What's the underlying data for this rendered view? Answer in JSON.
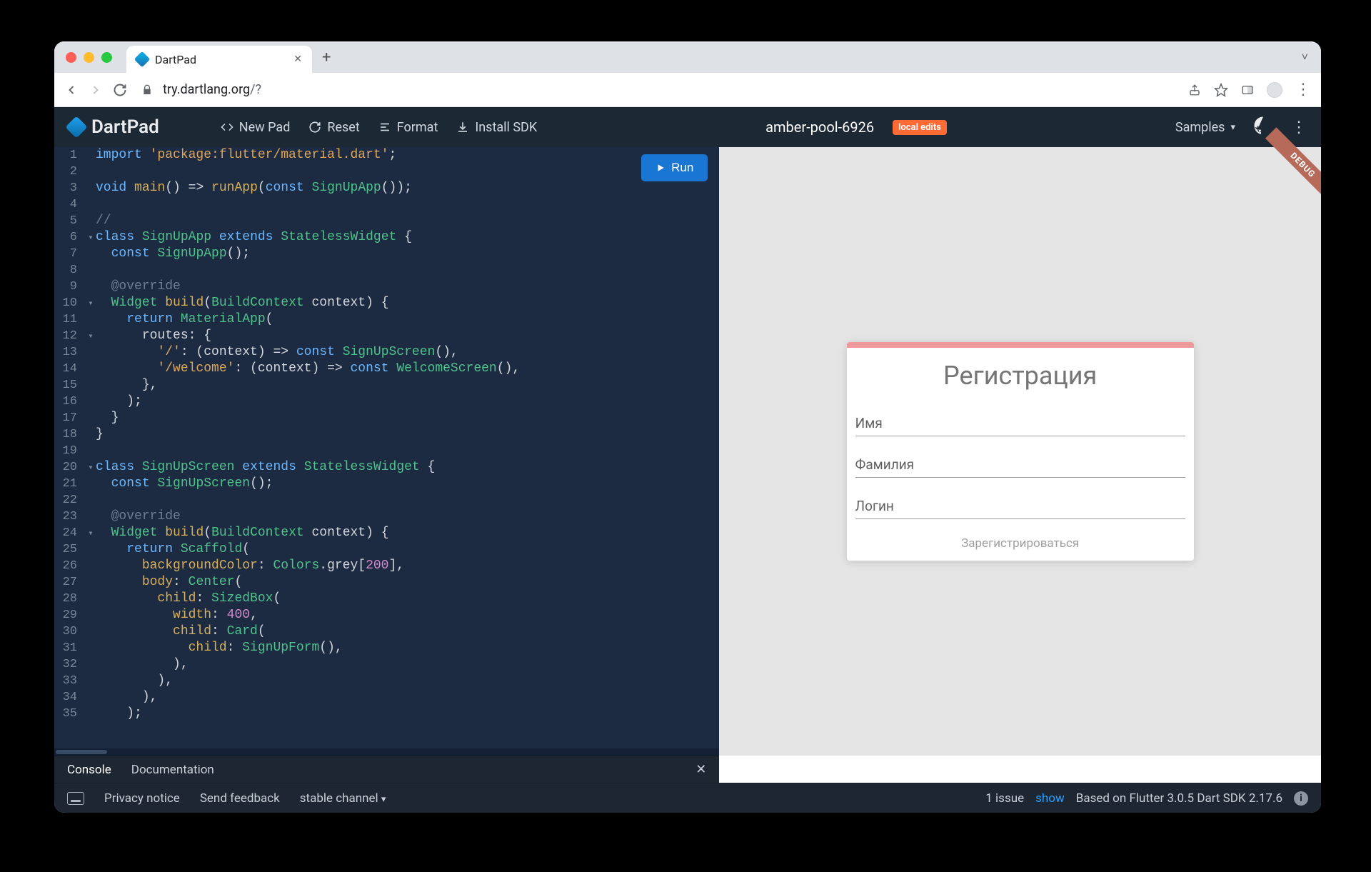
{
  "browser": {
    "tab_title": "DartPad",
    "url_host": "try.dartlang.org",
    "url_path": "/?",
    "nav": {
      "back": "←",
      "forward": "→",
      "reload": "↻",
      "share": "⎋",
      "star": "☆",
      "ext": "▭",
      "profile": "●",
      "menu": "⋮",
      "newtab": "+",
      "caret": "˅",
      "lock": "🔒"
    }
  },
  "header": {
    "brand": "DartPad",
    "buttons": {
      "new": "New Pad",
      "reset": "Reset",
      "format": "Format",
      "install": "Install SDK",
      "samples": "Samples"
    },
    "pad_name": "amber-pool-6926",
    "badge": "local edits"
  },
  "run_label": "Run",
  "code_lines": [
    {
      "n": "1",
      "fold": "",
      "html": "<span class='kw'>import</span> <span class='str'>'package:flutter/material.dart'</span><span class='pn'>;</span>"
    },
    {
      "n": "2",
      "fold": "",
      "html": ""
    },
    {
      "n": "3",
      "fold": "",
      "html": "<span class='kw'>void</span> <span class='fn'>main</span><span class='pn'>() =&gt; </span><span class='fn'>runApp</span><span class='pn'>(</span><span class='kw'>const</span> <span class='cls'>SignUpApp</span><span class='pn'>());</span>"
    },
    {
      "n": "4",
      "fold": "",
      "html": ""
    },
    {
      "n": "5",
      "fold": "",
      "html": "<span class='cmt'>//</span>"
    },
    {
      "n": "6",
      "fold": "▾",
      "html": "<span class='kw'>class</span> <span class='cls'>SignUpApp</span> <span class='kw'>extends</span> <span class='cls'>StatelessWidget</span> <span class='pn'>{</span>"
    },
    {
      "n": "7",
      "fold": "",
      "html": "  <span class='kw'>const</span> <span class='cls'>SignUpApp</span><span class='pn'>();</span>"
    },
    {
      "n": "8",
      "fold": "",
      "html": ""
    },
    {
      "n": "9",
      "fold": "",
      "html": "  <span class='cmt'>@override</span>"
    },
    {
      "n": "10",
      "fold": "▾",
      "html": "  <span class='cls'>Widget</span> <span class='fn'>build</span><span class='pn'>(</span><span class='cls'>BuildContext</span> <span class='pn'>context) {</span>"
    },
    {
      "n": "11",
      "fold": "",
      "html": "    <span class='kw'>return</span> <span class='cls'>MaterialApp</span><span class='pn'>(</span>"
    },
    {
      "n": "12",
      "fold": "▾",
      "html": "      <span class='pn'>routes: {</span>"
    },
    {
      "n": "13",
      "fold": "",
      "html": "        <span class='str'>'/'</span><span class='pn'>: (context) =&gt; </span><span class='kw'>const</span> <span class='cls'>SignUpScreen</span><span class='pn'>(),</span>"
    },
    {
      "n": "14",
      "fold": "",
      "html": "        <span class='str'>'/welcome'</span><span class='pn'>: (context) =&gt; </span><span class='kw'>const</span> <span class='cls'>WelcomeScreen</span><span class='pn'>(),</span>"
    },
    {
      "n": "15",
      "fold": "",
      "html": "      <span class='pn'>},</span>"
    },
    {
      "n": "16",
      "fold": "",
      "html": "    <span class='pn'>);</span>"
    },
    {
      "n": "17",
      "fold": "",
      "html": "  <span class='pn'>}</span>"
    },
    {
      "n": "18",
      "fold": "",
      "html": "<span class='pn'>}</span>"
    },
    {
      "n": "19",
      "fold": "",
      "html": ""
    },
    {
      "n": "20",
      "fold": "▾",
      "html": "<span class='kw'>class</span> <span class='cls'>SignUpScreen</span> <span class='kw'>extends</span> <span class='cls'>StatelessWidget</span> <span class='pn'>{</span>"
    },
    {
      "n": "21",
      "fold": "",
      "html": "  <span class='kw'>const</span> <span class='cls'>SignUpScreen</span><span class='pn'>();</span>"
    },
    {
      "n": "22",
      "fold": "",
      "html": ""
    },
    {
      "n": "23",
      "fold": "",
      "html": "  <span class='cmt'>@override</span>"
    },
    {
      "n": "24",
      "fold": "▾",
      "html": "  <span class='cls'>Widget</span> <span class='fn'>build</span><span class='pn'>(</span><span class='cls'>BuildContext</span> <span class='pn'>context) {</span>"
    },
    {
      "n": "25",
      "fold": "",
      "html": "    <span class='kw'>return</span> <span class='cls'>Scaffold</span><span class='pn'>(</span>"
    },
    {
      "n": "26",
      "fold": "",
      "html": "      <span class='fn'>backgroundColor</span><span class='pn'>: </span><span class='cls'>Colors</span><span class='pn'>.grey[</span><span class='num'>200</span><span class='pn'>],</span>"
    },
    {
      "n": "27",
      "fold": "",
      "html": "      <span class='fn'>body</span><span class='pn'>: </span><span class='cls'>Center</span><span class='pn'>(</span>"
    },
    {
      "n": "28",
      "fold": "",
      "html": "        <span class='fn'>child</span><span class='pn'>: </span><span class='cls'>SizedBox</span><span class='pn'>(</span>"
    },
    {
      "n": "29",
      "fold": "",
      "html": "          <span class='fn'>width</span><span class='pn'>: </span><span class='num'>400</span><span class='pn'>,</span>"
    },
    {
      "n": "30",
      "fold": "",
      "html": "          <span class='fn'>child</span><span class='pn'>: </span><span class='cls'>Card</span><span class='pn'>(</span>"
    },
    {
      "n": "31",
      "fold": "",
      "html": "            <span class='fn'>child</span><span class='pn'>: </span><span class='cls'>SignUpForm</span><span class='pn'>(),</span>"
    },
    {
      "n": "32",
      "fold": "",
      "html": "          <span class='pn'>),</span>"
    },
    {
      "n": "33",
      "fold": "",
      "html": "        <span class='pn'>),</span>"
    },
    {
      "n": "34",
      "fold": "",
      "html": "      <span class='pn'>),</span>"
    },
    {
      "n": "35",
      "fold": "",
      "html": "    <span class='pn'>);</span>"
    }
  ],
  "preview": {
    "debug": "DEBUG",
    "title": "Регистрация",
    "fields": {
      "first": "Имя",
      "last": "Фамилия",
      "login": "Логин"
    },
    "submit": "Зарегистрироваться"
  },
  "console": {
    "tabs": {
      "console": "Console",
      "doc": "Documentation"
    }
  },
  "status": {
    "privacy": "Privacy notice",
    "feedback": "Send feedback",
    "channel": "stable channel",
    "issues": "1 issue",
    "show": "show",
    "based": "Based on Flutter 3.0.5 Dart SDK 2.17.6"
  }
}
